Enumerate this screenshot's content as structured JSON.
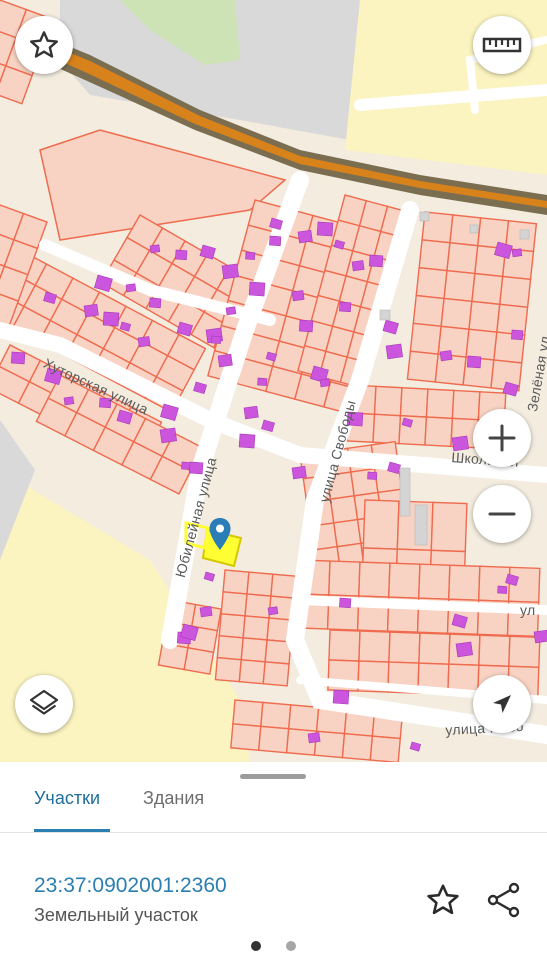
{
  "map": {
    "labels": {
      "street_khutorskaya": "Хуторская улица",
      "street_yubileynaya": "Юбилейная улица",
      "street_svobody": "улица Свободы",
      "street_zelenaya": "Зелёная ул",
      "street_shkolnaya": "Школьная",
      "street_novo": "улица Ново",
      "street_ul_right": "ул"
    },
    "controls": {
      "favorite_icon": "star-outline-icon",
      "ruler_icon": "ruler-icon",
      "zoom_in_icon": "plus-icon",
      "zoom_out_icon": "minus-icon",
      "layers_icon": "layers-icon",
      "location_icon": "navigation-arrow-icon"
    },
    "colors": {
      "parcel_border": "#ef6b4f",
      "parcel_fill": "#f8d2c2",
      "building": "#cc55dd",
      "road": "#ffffff",
      "highway": "#d7821a",
      "selected_parcel": "#ffff33",
      "selected_border": "#d5c800",
      "marker": "#2a7db6"
    }
  },
  "sheet": {
    "tabs": [
      {
        "label": "Участки",
        "active": true
      },
      {
        "label": "Здания",
        "active": false
      }
    ],
    "parcel": {
      "cadastral_number": "23:37:0902001:2360",
      "type": "Земельный участок"
    },
    "actions": {
      "favorite_icon": "star-outline-icon",
      "share_icon": "share-icon"
    },
    "pager": {
      "count": 2,
      "active_index": 0
    }
  }
}
